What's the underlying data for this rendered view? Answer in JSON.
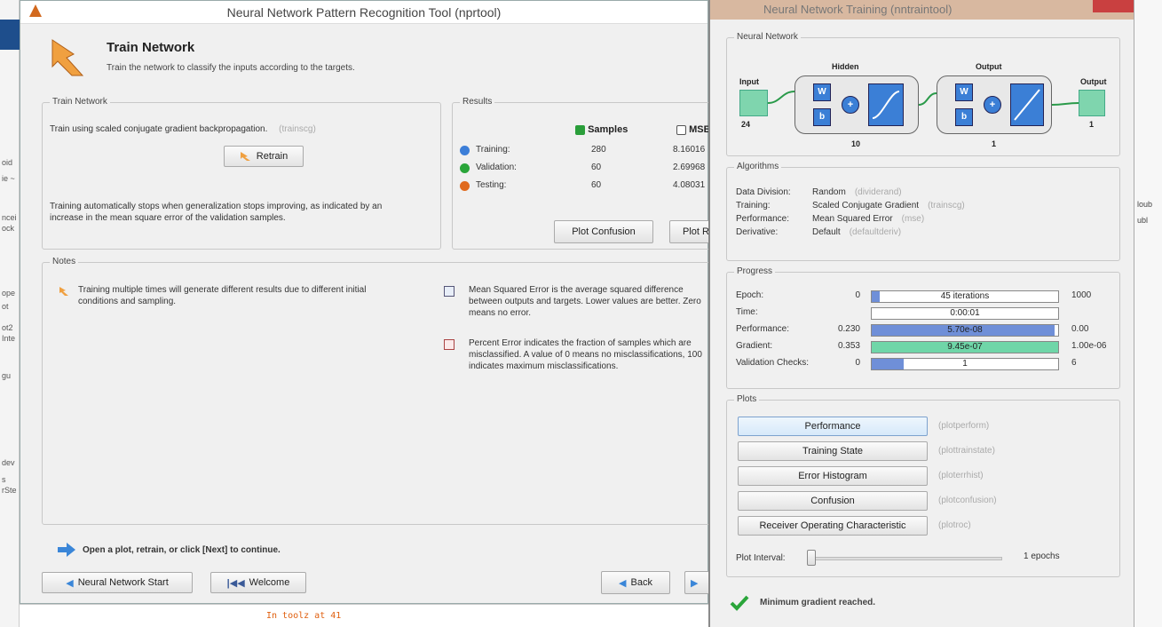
{
  "main_window": {
    "title": "Neural Network Pattern Recognition Tool (nprtool)",
    "header_title": "Train Network",
    "header_subtitle": "Train the network to classify the inputs according to the targets.",
    "train_panel": {
      "title": "Train Network",
      "description": "Train using scaled conjugate gradient backpropagation.",
      "description_fn": "(trainscg)",
      "retrain_label": "Retrain",
      "note": "Training automatically stops when generalization stops improving, as indicated by an increase in the mean square error of the validation samples."
    },
    "results_panel": {
      "title": "Results",
      "col_samples": "Samples",
      "col_mse": "MSE",
      "rows": [
        {
          "label": "Training:",
          "samples": "280",
          "mse": "8.16016",
          "color": "#3c7ed8"
        },
        {
          "label": "Validation:",
          "samples": "60",
          "mse": "2.69968",
          "color": "#2aa53a"
        },
        {
          "label": "Testing:",
          "samples": "60",
          "mse": "4.08031",
          "color": "#e06a1e"
        }
      ],
      "plot_confusion_label": "Plot Confusion",
      "plot_roc_label": "Plot ROC"
    },
    "notes_panel": {
      "title": "Notes",
      "note_left": "Training multiple times will generate different results due to different initial conditions and sampling.",
      "note_mse": "Mean Squared Error is the average squared difference between outputs and targets. Lower values are better. Zero means no error.",
      "note_pe": "Percent Error indicates the fraction of samples which are misclassified. A value of 0 means no misclassifications, 100 indicates maximum misclassifications."
    },
    "hint": "Open a plot, retrain, or click [Next] to continue.",
    "nn_start_label": "Neural Network Start",
    "welcome_label": "Welcome",
    "back_label": "Back",
    "command_line": "In toolz at 41"
  },
  "train_window": {
    "title": "Neural Network Training (nntraintool)",
    "neural_network": {
      "title": "Neural Network",
      "input_label": "Input",
      "input_size": "24",
      "hidden_label": "Hidden",
      "hidden_size": "10",
      "output_layer_label": "Output",
      "output_layer_size": "1",
      "output_label": "Output",
      "output_size": "1",
      "w": "W",
      "b": "b",
      "plus": "+"
    },
    "algorithms": {
      "title": "Algorithms",
      "rows": [
        {
          "label": "Data Division:",
          "value": "Random",
          "fn": "(dividerand)"
        },
        {
          "label": "Training:",
          "value": "Scaled Conjugate Gradient",
          "fn": "(trainscg)"
        },
        {
          "label": "Performance:",
          "value": "Mean Squared Error",
          "fn": "(mse)"
        },
        {
          "label": "Derivative:",
          "value": "Default",
          "fn": "(defaultderiv)"
        }
      ]
    },
    "progress": {
      "title": "Progress",
      "rows": [
        {
          "label": "Epoch:",
          "start": "0",
          "value": "45 iterations",
          "end": "1000",
          "fill": 0.045,
          "fill_color": "#6f8fd8"
        },
        {
          "label": "Time:",
          "start": "",
          "value": "0:00:01",
          "end": "",
          "fill": 0,
          "fill_color": "#6f8fd8"
        },
        {
          "label": "Performance:",
          "start": "0.230",
          "value": "5.70e-08",
          "end": "0.00",
          "fill": 0.98,
          "fill_color": "#6f8fd8"
        },
        {
          "label": "Gradient:",
          "start": "0.353",
          "value": "9.45e-07",
          "end": "1.00e-06",
          "fill": 1.0,
          "fill_color": "#6fd6a8"
        },
        {
          "label": "Validation Checks:",
          "start": "0",
          "value": "1",
          "end": "6",
          "fill": 0.17,
          "fill_color": "#6f8fd8"
        }
      ]
    },
    "plots": {
      "title": "Plots",
      "buttons": [
        {
          "label": "Performance",
          "fn": "(plotperform)"
        },
        {
          "label": "Training State",
          "fn": "(plottrainstate)"
        },
        {
          "label": "Error Histogram",
          "fn": "(ploterrhist)"
        },
        {
          "label": "Confusion",
          "fn": "(plotconfusion)"
        },
        {
          "label": "Receiver Operating Characteristic",
          "fn": "(plotroc)"
        }
      ],
      "interval_label": "Plot Interval:",
      "interval_value": "1 epochs"
    },
    "status": "Minimum gradient reached."
  },
  "background": {
    "left_fragments": [
      "oid",
      "ie ~",
      "ncei",
      "ock",
      "ope",
      "ot",
      "ot2",
      "Inte",
      "gu",
      "dev",
      "s",
      "rSte"
    ],
    "right_fragments": [
      "loub",
      "ubl"
    ]
  }
}
